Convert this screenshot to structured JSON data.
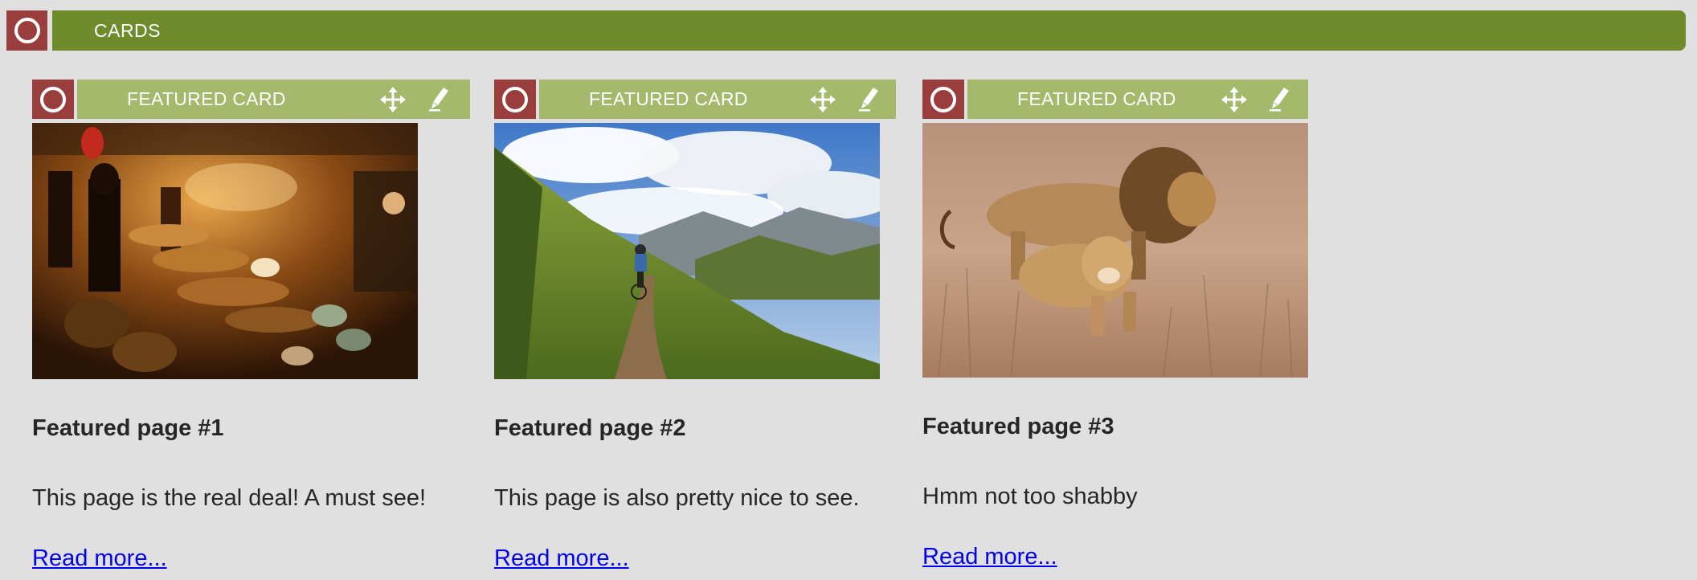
{
  "header": {
    "title": "CARDS"
  },
  "colors": {
    "header_bar": "#6f8c2c",
    "card_header": "#a5b96c",
    "toggle_button": "#993d3d",
    "background": "#e0e0e0",
    "link": "#0000ee"
  },
  "cards": [
    {
      "header_label": "FEATURED CARD",
      "image_icon": "market-food-stalls-photo",
      "title": "Featured page #1",
      "description": "This page is the real deal! A must see!",
      "link_text": "Read more..."
    },
    {
      "header_label": "FEATURED CARD",
      "image_icon": "mountain-biker-valley-photo",
      "title": "Featured page #2",
      "description": "This page is also pretty nice to see.",
      "link_text": "Read more..."
    },
    {
      "header_label": "FEATURED CARD",
      "image_icon": "lions-in-grass-photo",
      "title": "Featured page #3",
      "description": "Hmm not too shabby",
      "link_text": "Read more..."
    }
  ]
}
